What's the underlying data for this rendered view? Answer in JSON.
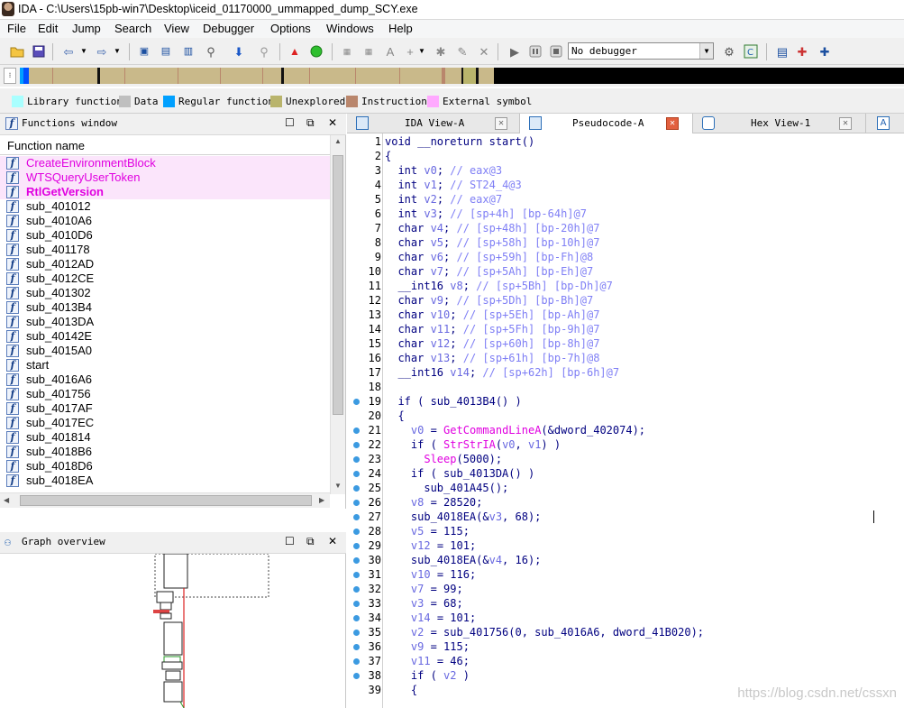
{
  "window": {
    "title": "IDA - C:\\Users\\15pb-win7\\Desktop\\iceid_01170000_ummapped_dump_SCY.exe"
  },
  "menu": [
    "File",
    "Edit",
    "Jump",
    "Search",
    "View",
    "Debugger",
    "Options",
    "Windows",
    "Help"
  ],
  "toolbar": {
    "debugger_selected": "No debugger"
  },
  "legend": [
    {
      "label": "Library function",
      "color": "#a9ffff"
    },
    {
      "label": "Data",
      "color": "#bfbfbf"
    },
    {
      "label": "Regular function",
      "color": "#00a0ff"
    },
    {
      "label": "Unexplored",
      "color": "#b9b46c"
    },
    {
      "label": "Instruction",
      "color": "#b9866c"
    },
    {
      "label": "External symbol",
      "color": "#ffa9ff"
    }
  ],
  "functions_window": {
    "title": "Functions window",
    "column_header": "Function name",
    "items": [
      {
        "name": "CreateEnvironmentBlock",
        "kind": "import"
      },
      {
        "name": "WTSQueryUserToken",
        "kind": "import"
      },
      {
        "name": "RtlGetVersion",
        "kind": "import-bold"
      },
      {
        "name": "sub_401012",
        "kind": "regular"
      },
      {
        "name": "sub_4010A6",
        "kind": "regular"
      },
      {
        "name": "sub_4010D6",
        "kind": "regular"
      },
      {
        "name": "sub_401178",
        "kind": "regular"
      },
      {
        "name": "sub_4012AD",
        "kind": "regular"
      },
      {
        "name": "sub_4012CE",
        "kind": "regular"
      },
      {
        "name": "sub_401302",
        "kind": "regular"
      },
      {
        "name": "sub_4013B4",
        "kind": "regular"
      },
      {
        "name": "sub_4013DA",
        "kind": "regular"
      },
      {
        "name": "sub_40142E",
        "kind": "regular"
      },
      {
        "name": "sub_4015A0",
        "kind": "regular"
      },
      {
        "name": "start",
        "kind": "regular"
      },
      {
        "name": "sub_4016A6",
        "kind": "regular"
      },
      {
        "name": "sub_401756",
        "kind": "regular"
      },
      {
        "name": "sub_4017AF",
        "kind": "regular"
      },
      {
        "name": "sub_4017EC",
        "kind": "regular"
      },
      {
        "name": "sub_401814",
        "kind": "regular"
      },
      {
        "name": "sub_4018B6",
        "kind": "regular"
      },
      {
        "name": "sub_4018D6",
        "kind": "regular"
      },
      {
        "name": "sub_4018EA",
        "kind": "regular"
      }
    ]
  },
  "graph_overview": {
    "title": "Graph overview"
  },
  "tabs": [
    {
      "label": "IDA View-A",
      "active": false
    },
    {
      "label": "Pseudocode-A",
      "active": true
    },
    {
      "label": "Hex View-1",
      "active": false
    }
  ],
  "code_lines": [
    {
      "n": "1",
      "bp": false,
      "text": "void __noreturn start()"
    },
    {
      "n": "2",
      "bp": false,
      "text": "{"
    },
    {
      "n": "3",
      "bp": false,
      "text": "  int v0; // eax@3"
    },
    {
      "n": "4",
      "bp": false,
      "text": "  int v1; // ST24_4@3"
    },
    {
      "n": "5",
      "bp": false,
      "text": "  int v2; // eax@7"
    },
    {
      "n": "6",
      "bp": false,
      "text": "  int v3; // [sp+4h] [bp-64h]@7"
    },
    {
      "n": "7",
      "bp": false,
      "text": "  char v4; // [sp+48h] [bp-20h]@7"
    },
    {
      "n": "8",
      "bp": false,
      "text": "  char v5; // [sp+58h] [bp-10h]@7"
    },
    {
      "n": "9",
      "bp": false,
      "text": "  char v6; // [sp+59h] [bp-Fh]@8"
    },
    {
      "n": "10",
      "bp": false,
      "text": "  char v7; // [sp+5Ah] [bp-Eh]@7"
    },
    {
      "n": "11",
      "bp": false,
      "text": "  __int16 v8; // [sp+5Bh] [bp-Dh]@7"
    },
    {
      "n": "12",
      "bp": false,
      "text": "  char v9; // [sp+5Dh] [bp-Bh]@7"
    },
    {
      "n": "13",
      "bp": false,
      "text": "  char v10; // [sp+5Eh] [bp-Ah]@7"
    },
    {
      "n": "14",
      "bp": false,
      "text": "  char v11; // [sp+5Fh] [bp-9h]@7"
    },
    {
      "n": "15",
      "bp": false,
      "text": "  char v12; // [sp+60h] [bp-8h]@7"
    },
    {
      "n": "16",
      "bp": false,
      "text": "  char v13; // [sp+61h] [bp-7h]@8"
    },
    {
      "n": "17",
      "bp": false,
      "text": "  __int16 v14; // [sp+62h] [bp-6h]@7"
    },
    {
      "n": "18",
      "bp": false,
      "text": ""
    },
    {
      "n": "19",
      "bp": true,
      "text": "  if ( sub_4013B4() )"
    },
    {
      "n": "20",
      "bp": false,
      "text": "  {"
    },
    {
      "n": "21",
      "bp": true,
      "text": "    v0 = GetCommandLineA(&dword_402074);"
    },
    {
      "n": "22",
      "bp": true,
      "text": "    if ( StrStrIA(v0, v1) )"
    },
    {
      "n": "23",
      "bp": true,
      "text": "      Sleep(5000);"
    },
    {
      "n": "24",
      "bp": true,
      "text": "    if ( sub_4013DA() )"
    },
    {
      "n": "25",
      "bp": true,
      "text": "      sub_401A45();"
    },
    {
      "n": "26",
      "bp": true,
      "text": "    v8 = 28520;"
    },
    {
      "n": "27",
      "bp": true,
      "text": "    sub_4018EA(&v3, 68);"
    },
    {
      "n": "28",
      "bp": true,
      "text": "    v5 = 115;"
    },
    {
      "n": "29",
      "bp": true,
      "text": "    v12 = 101;"
    },
    {
      "n": "30",
      "bp": true,
      "text": "    sub_4018EA(&v4, 16);"
    },
    {
      "n": "31",
      "bp": true,
      "text": "    v10 = 116;"
    },
    {
      "n": "32",
      "bp": true,
      "text": "    v7 = 99;"
    },
    {
      "n": "33",
      "bp": true,
      "text": "    v3 = 68;"
    },
    {
      "n": "34",
      "bp": true,
      "text": "    v14 = 101;"
    },
    {
      "n": "35",
      "bp": true,
      "text": "    v2 = sub_401756(0, sub_4016A6, dword_41B020);"
    },
    {
      "n": "36",
      "bp": true,
      "text": "    v9 = 115;"
    },
    {
      "n": "37",
      "bp": true,
      "text": "    v11 = 46;"
    },
    {
      "n": "38",
      "bp": true,
      "text": "    if ( v2 )"
    },
    {
      "n": "39",
      "bp": false,
      "text": "    {"
    }
  ],
  "watermark": "https://blog.csdn.net/cssxn"
}
